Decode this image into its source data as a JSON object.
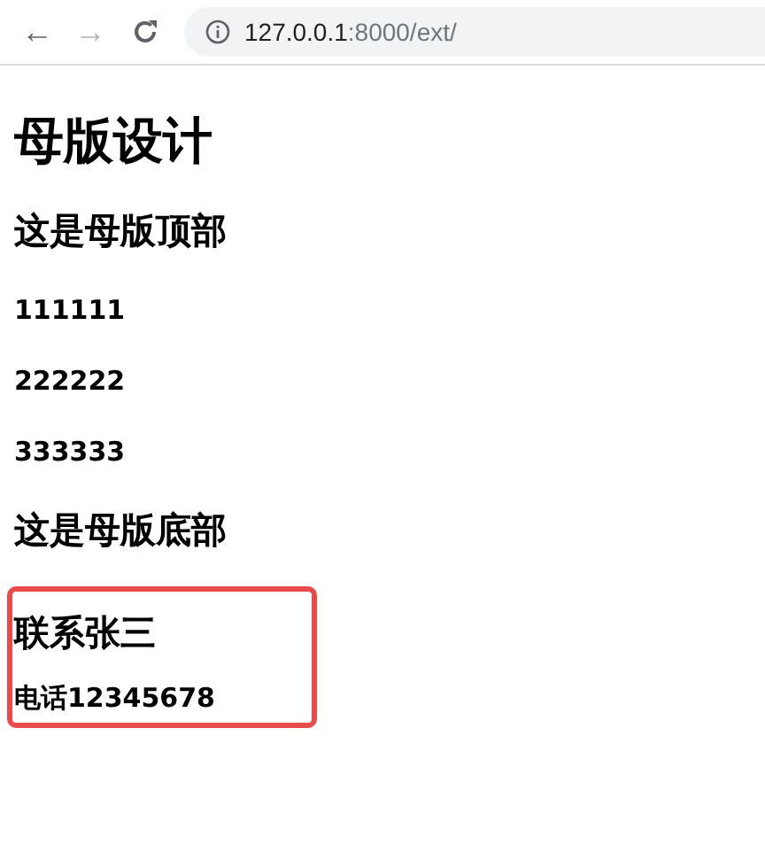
{
  "toolbar": {
    "back": "←",
    "forward": "→",
    "url": "**127.0.0.1**:8000/ext/"
  },
  "page": [
    {
      "kind": "h1",
      "text": "母版设计"
    },
    {
      "kind": "h2",
      "text": "这是母版顶部"
    },
    {
      "kind": "p",
      "text": "111111"
    },
    {
      "kind": "p",
      "text": "222222"
    },
    {
      "kind": "p",
      "text": "333333"
    },
    {
      "kind": "h2",
      "text": "这是母版底部"
    }
  ],
  "highlight": {
    "color": "#e94b4b",
    "items": [
      {
        "kind": "h2",
        "text": "联系张三"
      },
      {
        "kind": "p",
        "text": "电话12345678"
      }
    ]
  }
}
